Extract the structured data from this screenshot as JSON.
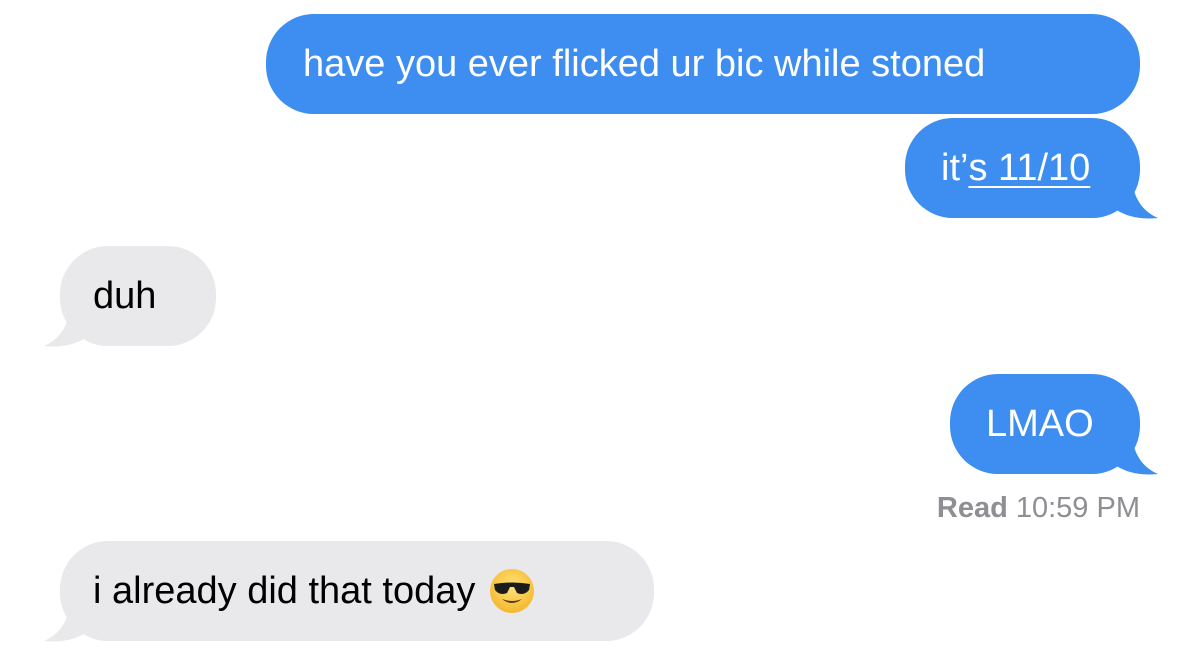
{
  "conversation": {
    "messages": [
      {
        "direction": "sent",
        "text": "have you ever flicked ur bic while stoned"
      },
      {
        "direction": "sent",
        "text_prefix": "it’",
        "text_link": "s 11/10"
      },
      {
        "direction": "received",
        "text": "duh"
      },
      {
        "direction": "sent",
        "text": "LMAO"
      },
      {
        "direction": "received",
        "text": "i already did that today",
        "emoji": "smiling-face-with-sunglasses-icon"
      }
    ],
    "read_receipt": {
      "label": "Read",
      "time": "10:59 PM"
    }
  },
  "colors": {
    "sent_bubble": "#3d8ef0",
    "received_bubble": "#e9e9eb",
    "receipt_text": "#8e8e93",
    "background": "#ffffff"
  }
}
